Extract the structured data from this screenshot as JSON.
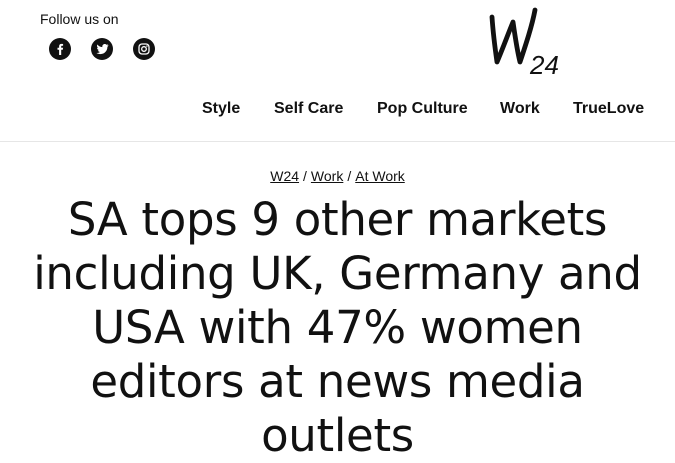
{
  "header": {
    "follow_label": "Follow us on",
    "social": [
      {
        "icon": "facebook-icon"
      },
      {
        "icon": "twitter-icon"
      },
      {
        "icon": "instagram-icon"
      }
    ],
    "logo": {
      "main": "W",
      "sub": "24"
    }
  },
  "nav": {
    "items": [
      {
        "label": "Style"
      },
      {
        "label": "Self Care"
      },
      {
        "label": "Pop Culture"
      },
      {
        "label": "Work"
      },
      {
        "label": "TrueLove"
      }
    ]
  },
  "breadcrumb": {
    "items": [
      {
        "label": "W24"
      },
      {
        "label": "Work"
      },
      {
        "label": "At Work"
      }
    ],
    "separator": "/"
  },
  "article": {
    "title": "SA tops 9 other markets including UK, Germany and USA with 47% women editors at news media outlets"
  },
  "colors": {
    "text": "#111111",
    "background": "#ffffff",
    "divider": "#e6e6e6"
  }
}
